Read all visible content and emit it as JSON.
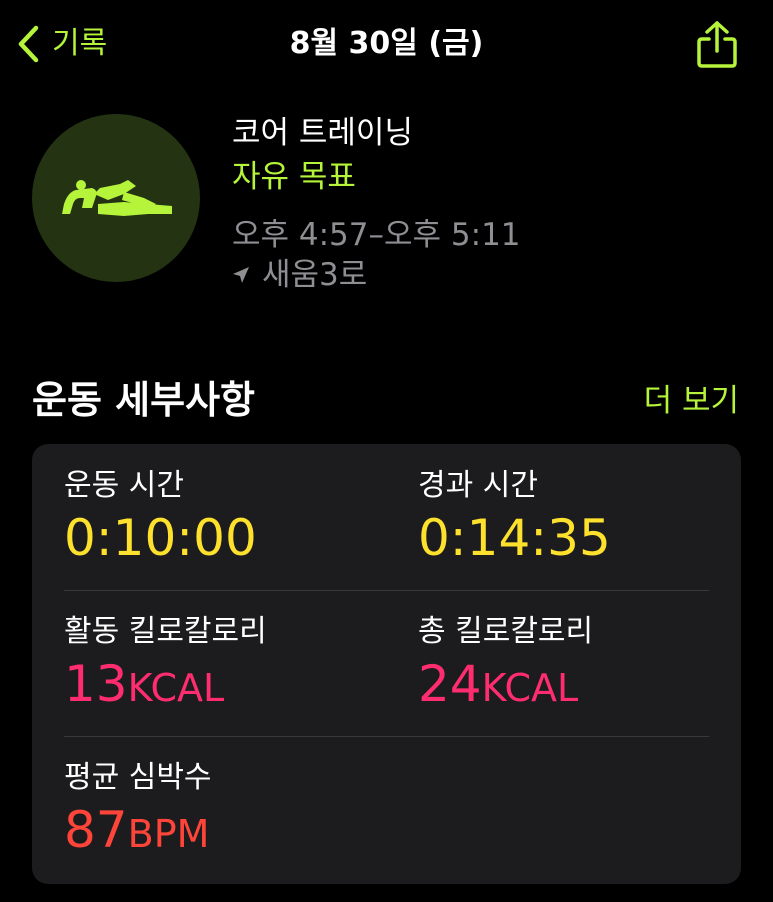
{
  "colors": {
    "accent_green": "#b5f43a",
    "yellow": "#fde12d",
    "pink": "#ff2d6f",
    "red_orange": "#ff453a",
    "secondary_text": "#8e8e93",
    "card_bg": "#1c1c1e"
  },
  "nav": {
    "back_label": "기록",
    "back_icon": "chevron-left-icon",
    "title": "8월 30일 (금)",
    "share_icon": "share-icon"
  },
  "workout": {
    "icon": "core-training-icon",
    "name": "코어 트레이닝",
    "goal": "자유 목표",
    "time_range": "오후 4:57–오후 5:11",
    "location_icon": "location-arrow-icon",
    "location": "새움3로"
  },
  "details": {
    "title": "운동 세부사항",
    "see_more": "더 보기",
    "workout_time": {
      "label": "운동 시간",
      "value": "0:10:00"
    },
    "elapsed_time": {
      "label": "경과 시간",
      "value": "0:14:35"
    },
    "active_calories": {
      "label": "활동 킬로칼로리",
      "value": "13",
      "unit": "KCAL"
    },
    "total_calories": {
      "label": "총 킬로칼로리",
      "value": "24",
      "unit": "KCAL"
    },
    "avg_heart_rate": {
      "label": "평균 심박수",
      "value": "87",
      "unit": "BPM"
    }
  }
}
